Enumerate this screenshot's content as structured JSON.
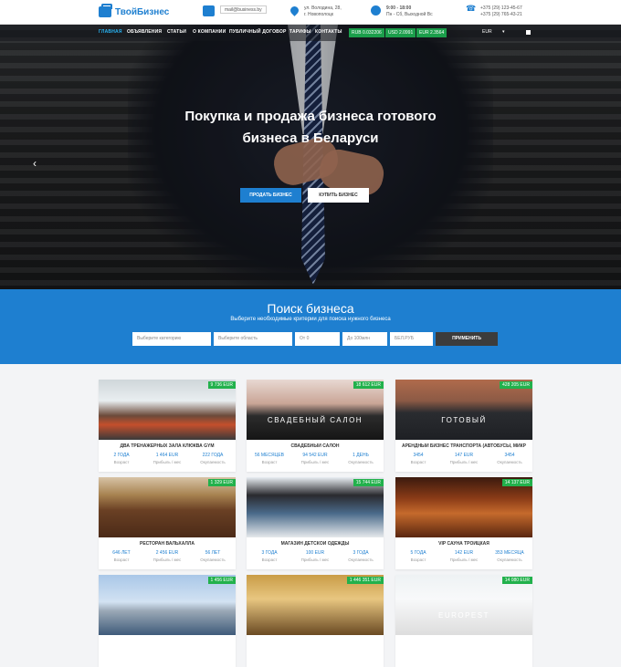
{
  "header": {
    "logo": "ТвойБизнес",
    "email": "mail@business.by",
    "address": [
      "ул. Володина, 28,",
      "г. Новополоцк"
    ],
    "hours": [
      "9:00 - 18:00",
      "Пн - Сб, Выходной Вс"
    ],
    "phones": [
      "+375 (29) 123-45-67",
      "+375 (29) 765-43-21"
    ]
  },
  "nav": {
    "items": [
      "ГЛАВНАЯ",
      "ОБЪЯВЛЕНИЯ",
      "СТАТЬИ",
      "О КОМПАНИИ",
      "ПУБЛИЧНЫЙ ДОГОВОР",
      "ТАРИФЫ",
      "КОНТАКТЫ"
    ],
    "rates": [
      "RUB 0.032206",
      "USD 2.0991",
      "EUR 2.3564"
    ],
    "currency": "EUR"
  },
  "hero": {
    "title_line1": "Покупка и продажа бизнеса готового",
    "title_line2": "бизнеса в Беларуси",
    "sell_button": "ПРОДАТЬ БИЗНЕС",
    "buy_button": "КУПИТЬ БИЗНЕС"
  },
  "search": {
    "title": "Поиск бизнеса",
    "subtitle": "Выберите необходимые критерии для поиска нужного бизнеса",
    "category_placeholder": "Выберите категорию",
    "region_placeholder": "Выберите область",
    "from_placeholder": "От 0",
    "to_placeholder": "До 100млн",
    "currency": "БЕЛ.РУБ",
    "button": "ПРИМЕНИТЬ"
  },
  "listings": [
    {
      "price": "9 736 EUR",
      "title": "ДВА ТРЕНАЖЕРНЫХ ЗАЛА КЛЮКВА GYM",
      "age": "2 ГОДА",
      "profit": "1 464 EUR",
      "payback": "222 ГОДА",
      "age_label": "Возраст",
      "profit_label": "Прибыль / мес",
      "payback_label": "Окупаемость",
      "image_text": ""
    },
    {
      "price": "18 612 EUR",
      "title": "СВАДЕБНЫЙ САЛОН",
      "age": "56 МЕСЯЦЕВ",
      "profit": "94 542 EUR",
      "payback": "1 ДЕНЬ",
      "age_label": "Возраст",
      "profit_label": "Прибыль / мес",
      "payback_label": "Окупаемость",
      "image_text": "СВАДЕБНЫЙ САЛОН"
    },
    {
      "price": "428 205 EUR",
      "title": "АРЕНДНЫЙ БИЗНЕС ТРАНСПОРТА (АВТОБУСЫ, МИКР",
      "age": "3454",
      "profit": "147 EUR",
      "payback": "3454",
      "age_label": "Возраст",
      "profit_label": "Прибыль / мес",
      "payback_label": "Окупаемость",
      "image_text": "ГОТОВЫЙ"
    },
    {
      "price": "1 329 EUR",
      "title": "РЕСТОРАН ВАЛЬХАЛЛА",
      "age": "646 ЛЕТ",
      "profit": "2 456 EUR",
      "payback": "56 ЛЕТ",
      "age_label": "Возраст",
      "profit_label": "Прибыль / мес",
      "payback_label": "Окупаемость",
      "image_text": ""
    },
    {
      "price": "15 744 EUR",
      "title": "МАГАЗИН ДЕТСКОЙ ОДЕЖДЫ",
      "age": "3 ГОДА",
      "profit": "100 EUR",
      "payback": "3 ГОДА",
      "age_label": "Возраст",
      "profit_label": "Прибыль / мес",
      "payback_label": "Окупаемость",
      "image_text": ""
    },
    {
      "price": "14 137 EUR",
      "title": "VIP САУНА ТРОИЦКАЯ",
      "age": "5 ГОДА",
      "profit": "142 EUR",
      "payback": "353 МЕСЯЦА",
      "age_label": "Возраст",
      "profit_label": "Прибыль / мес",
      "payback_label": "Окупаемость",
      "image_text": ""
    },
    {
      "price": "1 456 EUR",
      "title": "",
      "age": "",
      "profit": "",
      "payback": "",
      "age_label": "",
      "profit_label": "",
      "payback_label": "",
      "image_text": ""
    },
    {
      "price": "1 446 351 EUR",
      "title": "",
      "age": "",
      "profit": "",
      "payback": "",
      "age_label": "",
      "profit_label": "",
      "payback_label": "",
      "image_text": ""
    },
    {
      "price": "14 080 EUR",
      "title": "",
      "age": "",
      "profit": "",
      "payback": "",
      "age_label": "",
      "profit_label": "",
      "payback_label": "",
      "image_text": "EUROPEST"
    }
  ],
  "colors": {
    "brand": "#1e7fd0",
    "badge": "#22b14c",
    "rate_badge": "#1b9e4b"
  }
}
